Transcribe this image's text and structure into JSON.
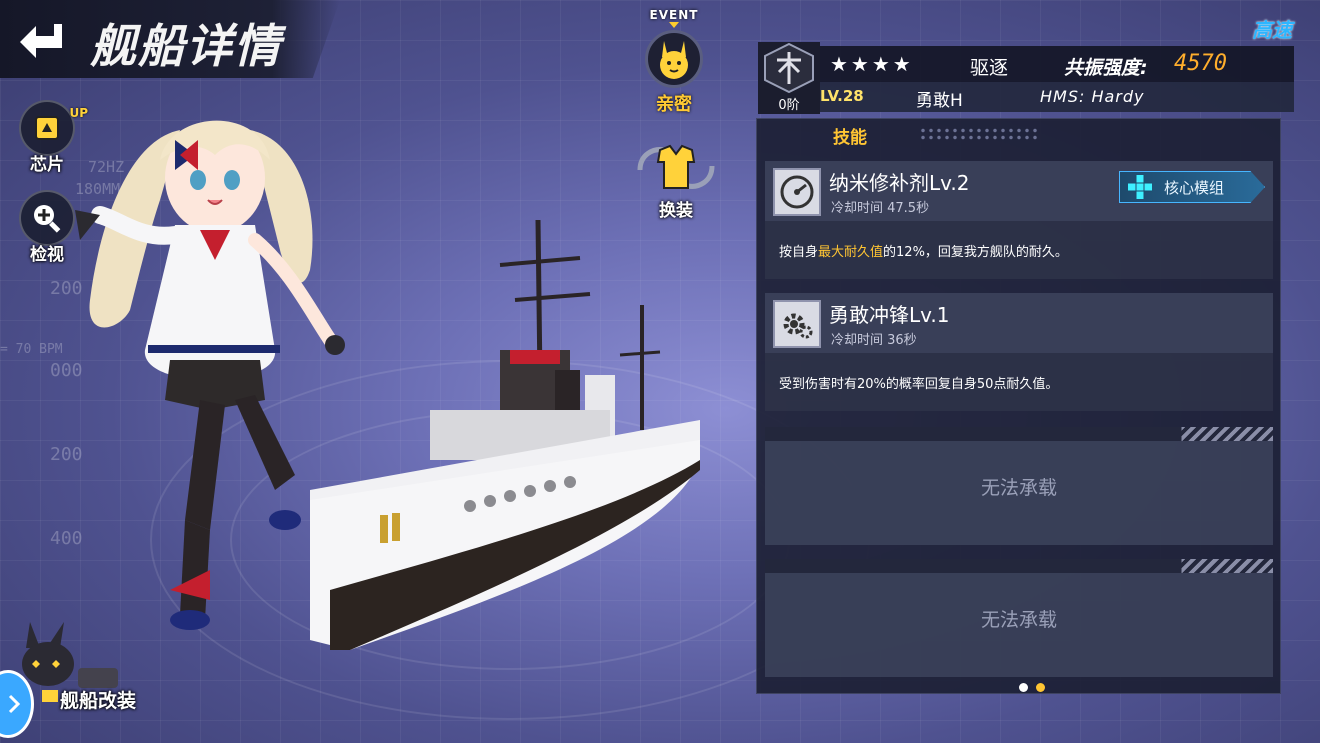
{
  "header": {
    "title": "舰船详情"
  },
  "event": {
    "badge": "EVENT",
    "affinity_label": "亲密"
  },
  "outfit": {
    "label": "换装"
  },
  "left_menu": {
    "chip_label": "芯片",
    "chip_up": "UP",
    "inspect_label": "检视"
  },
  "speed_tag": "高速",
  "ship_info": {
    "rank_label": "0阶",
    "stars": "★★★★",
    "type": "驱逐",
    "resonance_label": "共振强度:",
    "resonance_value": "4570",
    "level": "LV.28",
    "name": "勇敢H",
    "code": "HMS: Hardy"
  },
  "panel": {
    "tab_skills": "技能",
    "skills": [
      {
        "name": "纳米修补剂Lv.2",
        "cooldown": "冷却时间 47.5秒",
        "desc_prefix": "按自身",
        "desc_highlight": "最大耐久值",
        "desc_suffix": "的12%，回复我方舰队的耐久。",
        "core_button": "核心模组"
      },
      {
        "name": "勇敢冲锋Lv.1",
        "cooldown": "冷却时间 36秒",
        "desc": "受到伤害时有20%的概率回复自身50点耐久值。"
      }
    ],
    "empty_slots": [
      "无法承载",
      "无法承载"
    ],
    "pager": {
      "count": 2,
      "active": 1
    }
  },
  "bottom": {
    "modify_label": "舰船改装"
  },
  "background": {
    "scale_numbers": [
      "200",
      "000",
      "200",
      "400"
    ],
    "bpm": "= 70 BPM",
    "hz": "72HZ",
    "mm": "180MM"
  },
  "colors": {
    "accent_gold": "#ffc533",
    "resonance_orange": "#ffae2c",
    "speed_blue": "#2db6ff",
    "core_cyan": "#47b6ff"
  }
}
